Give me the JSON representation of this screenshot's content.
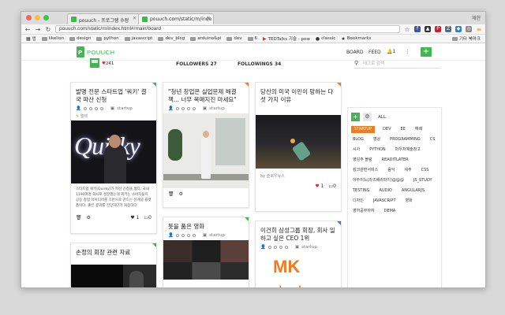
{
  "browser": {
    "profile": "재현",
    "tabs": [
      {
        "label": "pouuch - 프로그램 수정",
        "active": false
      },
      {
        "label": "pouuch.com/static/m/inde",
        "active": true
      }
    ],
    "url": "pouuch.com/static/m/index.html#/main/board",
    "bookmarks": [
      "앱",
      "likelion",
      "design",
      "python",
      "javascript",
      "dev_blog",
      "arduino&pi",
      "dev",
      "6",
      "TEDTalks 기술 - pow",
      "classic",
      "Bookmarks",
      "기타 북마크"
    ]
  },
  "app": {
    "brand": "POUUCH",
    "nav": {
      "board": "BOARD",
      "feed": "FEED",
      "notifications": "1",
      "more": "⋮",
      "add": "+"
    },
    "profile": {
      "likes": "241"
    },
    "followers": "FOLLOWERS 27",
    "followings": "FOLLOWINGS 34",
    "tag_search_placeholder": "태그로 검색"
  },
  "cards": [
    {
      "title": "발명 전문 스타트업 '쿼키' 결국 파산 신청",
      "category": "startup",
      "sub": "엘렉",
      "body": "스타트업 쿼키(Quirky)가 파산 신청을 했다. 국내 1190여명 회사로 성장했는데 쿼키는 소비자들이 공동 창업 아이디어를 기반으로 만드는 신개념 플랫폼이다. 좋은 결과를 전망하다가 처참하다",
      "likes": "1",
      "comments": "0"
    },
    {
      "title": "\"청년 창업은 실업문제 해결책... 너무 목매지진 마세요\"",
      "category": "startup"
    },
    {
      "title": "당신의 미국 이민이 망하는 다섯 가지 이유",
      "author": "by 슬로우뉴스",
      "likes": "1",
      "comments": "0"
    },
    {
      "title": "뜻을 품은 영화",
      "category": "startup"
    },
    {
      "title": "이건희 삼성그룹 회장, 회사 일 하고 싶은 CEO 1위",
      "category": "startup"
    },
    {
      "title": "손정의 회장 관련 자료"
    }
  ],
  "tags_panel": {
    "all": "ALL",
    "tags": [
      {
        "label": "STARTUP",
        "selected": true
      },
      {
        "label": "DEV",
        "selected": false
      },
      {
        "label": "EE",
        "selected": false
      },
      {
        "label": "예배",
        "selected": false
      },
      {
        "label": "BLOG",
        "selected": false
      },
      {
        "label": "영상",
        "selected": false
      },
      {
        "label": "PROGRAMMING",
        "selected": false
      },
      {
        "label": "CS",
        "selected": false
      },
      {
        "label": "시사",
        "selected": false
      },
      {
        "label": "PYTHON",
        "selected": false
      },
      {
        "label": "마우저예술창고",
        "selected": false
      },
      {
        "label": "영감주 블랑",
        "selected": false
      },
      {
        "label": "READITLATER",
        "selected": false
      },
      {
        "label": "킹크관련서비스",
        "selected": false
      },
      {
        "label": "음악",
        "selected": false
      },
      {
        "label": "세주",
        "selected": false
      },
      {
        "label": "CSS",
        "selected": false
      },
      {
        "label": "아두이노(라즈베리파이)@@@",
        "selected": false
      },
      {
        "label": "JS_STUDY",
        "selected": false
      },
      {
        "label": "TESTING",
        "selected": false
      },
      {
        "label": "AUDIO",
        "selected": false
      },
      {
        "label": "ANGULARJS",
        "selected": false
      },
      {
        "label": "디자인",
        "selected": false
      },
      {
        "label": "JAVASCRIPT",
        "selected": false
      },
      {
        "label": "영화",
        "selected": false
      },
      {
        "label": "영어공부하자",
        "selected": false
      },
      {
        "label": "DEMA",
        "selected": false
      }
    ]
  },
  "colors": {
    "brand_green": "#3fb850",
    "accent_orange": "#f27a1f",
    "like_red": "#d32f2f"
  }
}
